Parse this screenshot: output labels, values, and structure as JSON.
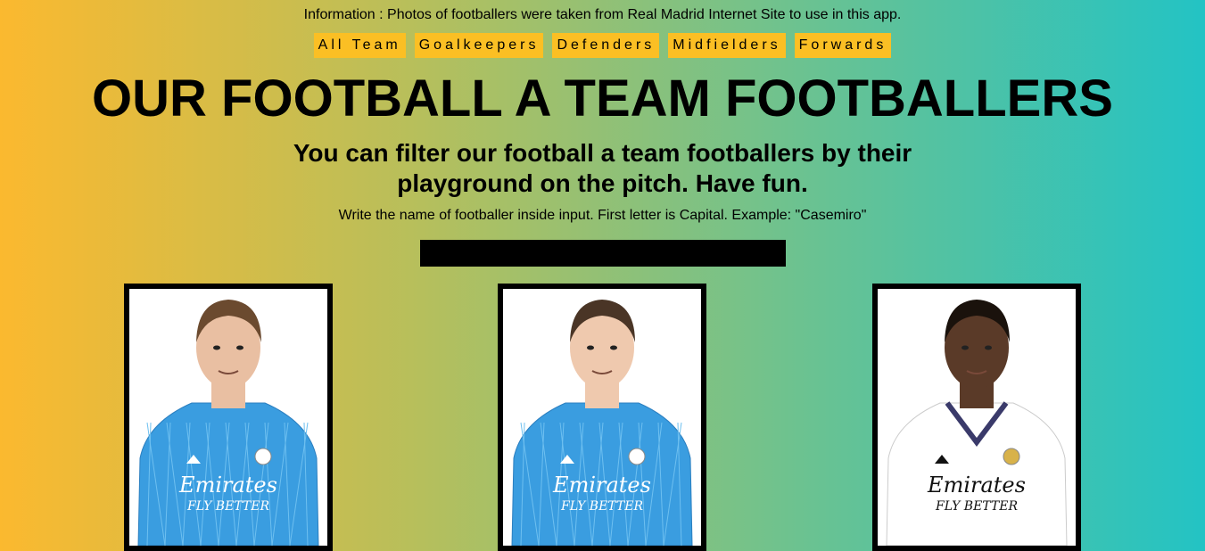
{
  "info_text": "Information : Photos of footballers were taken from Real Madrid Internet Site to use in this app.",
  "filters": [
    "All Team",
    "Goalkeepers",
    "Defenders",
    "Midfielders",
    "Forwards"
  ],
  "title": "OUR FOOTBALL A TEAM FOOTBALLERS",
  "subtitle": "You can filter our football a team footballers by their playground on the pitch. Have fun.",
  "hint": "Write the name of footballer inside input. First letter is Capital. Example: \"Casemiro\"",
  "search": {
    "value": "",
    "placeholder": ""
  },
  "players": [
    {
      "kit": "goalkeeper",
      "kit_color": "#3a9de0",
      "skin": "#e9bfa2",
      "hair": "#6b4a2f",
      "sponsor": "Emirates",
      "sponsor_sub": "FLY BETTER"
    },
    {
      "kit": "goalkeeper",
      "kit_color": "#3a9de0",
      "skin": "#efc9ae",
      "hair": "#4a3526",
      "sponsor": "Emirates",
      "sponsor_sub": "FLY BETTER"
    },
    {
      "kit": "home",
      "kit_color": "#ffffff",
      "skin": "#5a3a28",
      "hair": "#1a120c",
      "sponsor": "Emirates",
      "sponsor_sub": "FLY BETTER"
    }
  ]
}
